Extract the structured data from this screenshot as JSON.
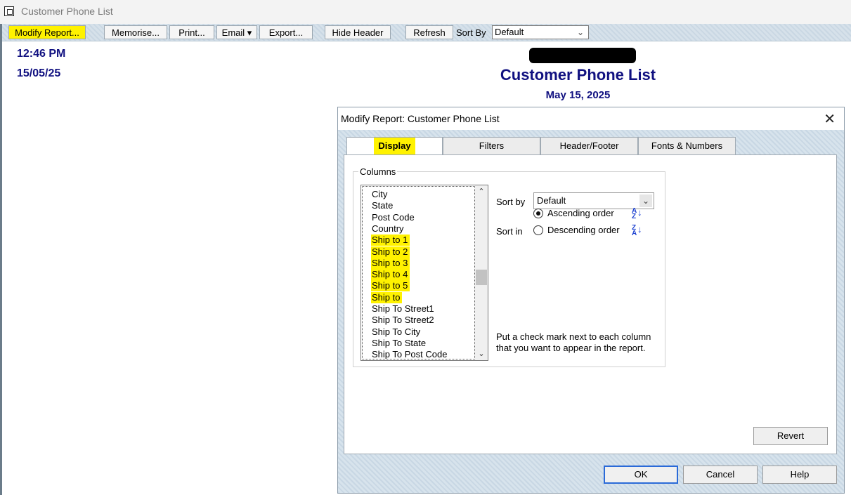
{
  "window": {
    "title": "Customer Phone List"
  },
  "toolbar": {
    "modify_report": "Modify Report...",
    "memorise": "Memorise...",
    "print": "Print...",
    "email": "Email ▾",
    "export": "Export...",
    "hide_header": "Hide Header",
    "refresh": "Refresh",
    "sort_by_label": "Sort By",
    "sort_by_value": "Default"
  },
  "report": {
    "time": "12:46 PM",
    "date_short": "15/05/25",
    "title": "Customer Phone List",
    "date": "May 15, 2025"
  },
  "dialog": {
    "title": "Modify Report: Customer Phone List",
    "tabs": [
      {
        "label": "Display"
      },
      {
        "label": "Filters"
      },
      {
        "label": "Header/Footer"
      },
      {
        "label": "Fonts & Numbers"
      }
    ],
    "columns_label": "Columns",
    "columns": [
      {
        "label": "City",
        "highlighted": false
      },
      {
        "label": "State",
        "highlighted": false
      },
      {
        "label": "Post Code",
        "highlighted": false
      },
      {
        "label": "Country",
        "highlighted": false
      },
      {
        "label": "Ship to 1",
        "highlighted": true
      },
      {
        "label": "Ship to 2",
        "highlighted": true
      },
      {
        "label": "Ship to 3",
        "highlighted": true
      },
      {
        "label": "Ship to 4",
        "highlighted": true
      },
      {
        "label": "Ship to 5",
        "highlighted": true
      },
      {
        "label": "Ship to",
        "highlighted": true
      },
      {
        "label": "Ship To Street1",
        "highlighted": false
      },
      {
        "label": "Ship To Street2",
        "highlighted": false
      },
      {
        "label": "Ship To City",
        "highlighted": false
      },
      {
        "label": "Ship To State",
        "highlighted": false
      },
      {
        "label": "Ship To Post Code",
        "highlighted": false
      }
    ],
    "sort_by_label": "Sort by",
    "sort_by_value": "Default",
    "sort_in_label": "Sort in",
    "ascending_label": "Ascending order",
    "descending_label": "Descending order",
    "sort_order_selected": "ascending",
    "help_text": "Put a check mark next to each column that you want to appear in the report.",
    "revert": "Revert",
    "ok": "OK",
    "cancel": "Cancel",
    "help": "Help"
  },
  "colors": {
    "highlight": "#fff200",
    "report_blue": "#101080"
  }
}
